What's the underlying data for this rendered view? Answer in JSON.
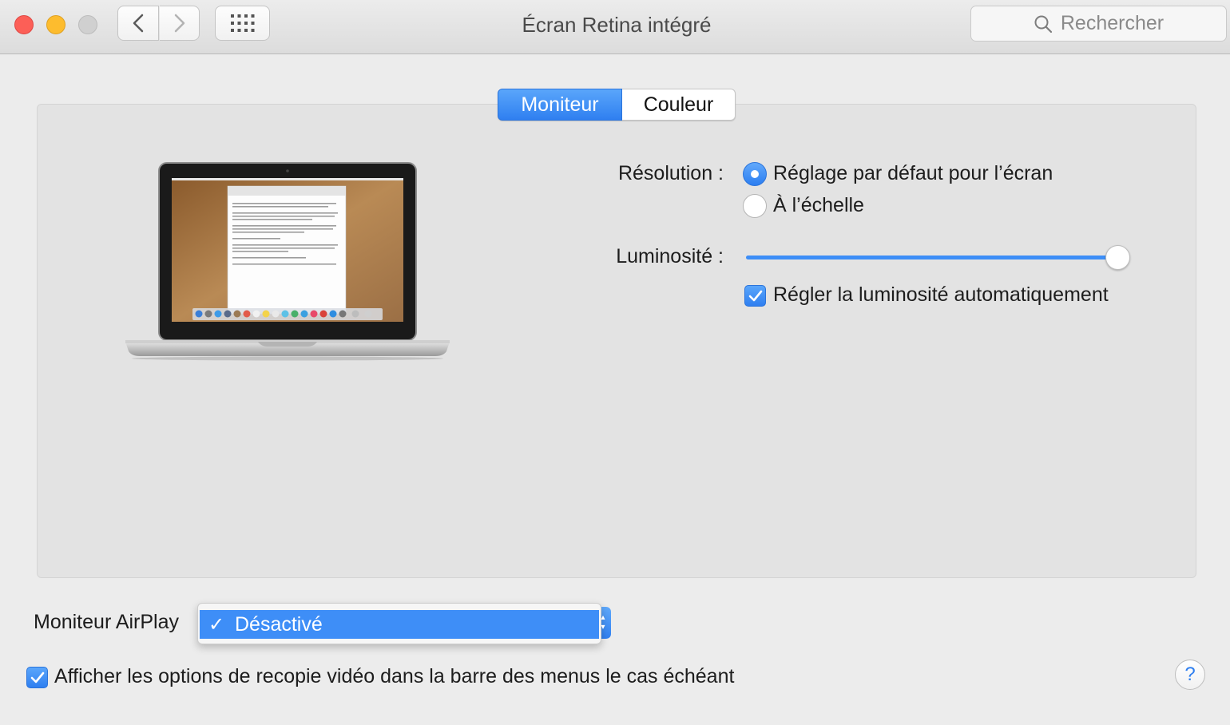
{
  "window": {
    "title": "Écran Retina intégré"
  },
  "search": {
    "placeholder": "Rechercher"
  },
  "tabs": [
    {
      "label": "Moniteur",
      "selected": true
    },
    {
      "label": "Couleur",
      "selected": false
    }
  ],
  "resolution": {
    "label": "Résolution :",
    "options": [
      {
        "label": "Réglage par défaut pour l’écran",
        "selected": true
      },
      {
        "label": "À l’échelle",
        "selected": false
      }
    ]
  },
  "brightness": {
    "label": "Luminosité :",
    "level": 0.99,
    "auto_label": "Régler la luminosité automatiquement",
    "auto_checked": true
  },
  "airplay": {
    "label": "Moniteur AirPlay",
    "selected_option": "Désactivé",
    "check": "✓"
  },
  "mirroring": {
    "label": "Afficher les options de recopie vidéo dans la barre des menus le cas échéant",
    "checked": true
  },
  "help": {
    "label": "?"
  },
  "colors": {
    "accent": "#3e8ef7",
    "window_bg": "#ececec",
    "panel_bg": "#e3e3e3"
  }
}
